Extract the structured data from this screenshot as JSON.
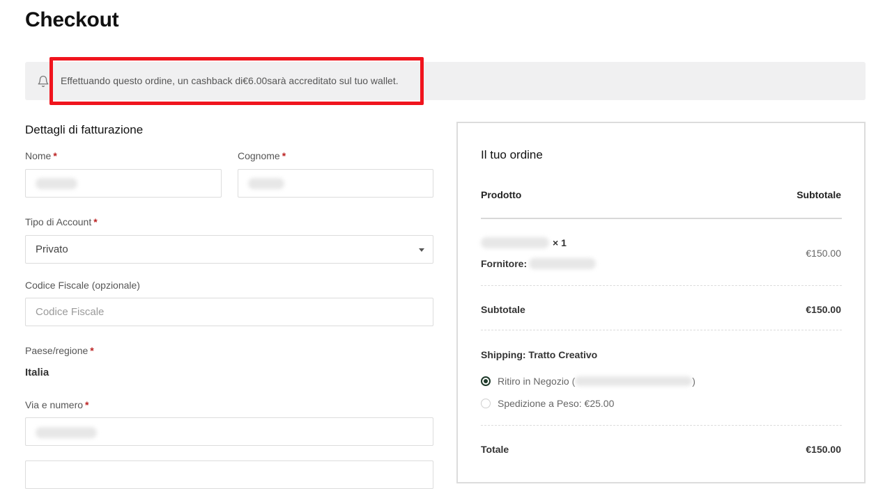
{
  "page": {
    "title": "Checkout"
  },
  "notice": {
    "text": "Effettuando questo ordine, un cashback di€6.00sarà accreditato sul tuo wallet.",
    "icon": "bell-icon"
  },
  "billing": {
    "title": "Dettagli di fatturazione",
    "required_mark": "*",
    "first_name_label": "Nome",
    "last_name_label": "Cognome",
    "account_type_label": "Tipo di Account",
    "account_type_value": "Privato",
    "tax_code_label": "Codice Fiscale (opzionale)",
    "tax_code_placeholder": "Codice Fiscale",
    "country_label": "Paese/regione",
    "country_value": "Italia",
    "street_label": "Via e numero"
  },
  "order": {
    "title": "Il tuo ordine",
    "col_product": "Prodotto",
    "col_subtotal": "Subtotale",
    "item_qty": "× 1",
    "item_price": "€150.00",
    "supplier_label": "Fornitore:",
    "subtotal_label": "Subtotale",
    "subtotal_value": "€150.00",
    "shipping_label": "Shipping: Tratto Creativo",
    "shipping_options": [
      {
        "label": "Ritiro in Negozio (",
        "suffix": ")",
        "selected": true
      },
      {
        "label": "Spedizione a Peso: €25.00",
        "selected": false
      }
    ],
    "total_label": "Totale",
    "total_value": "€150.00"
  },
  "colors": {
    "highlight": "#f0141d",
    "radio_selected": "#1f3a2a",
    "required": "#bb2222"
  }
}
